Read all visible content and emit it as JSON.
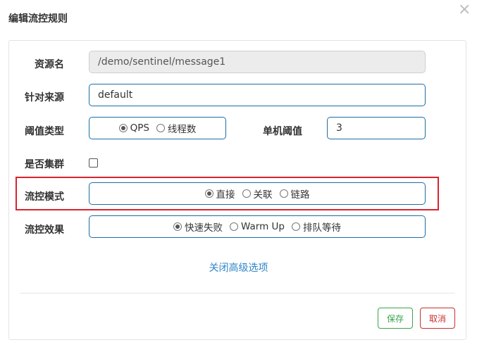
{
  "dialog": {
    "title": "编辑流控规则",
    "close_symbol": "×"
  },
  "form": {
    "resource": {
      "label": "资源名",
      "value": "/demo/sentinel/message1"
    },
    "limit_app": {
      "label": "针对来源",
      "value": "default"
    },
    "threshold_type": {
      "label": "阈值类型",
      "options": [
        "QPS",
        "线程数"
      ],
      "selected": "QPS"
    },
    "threshold": {
      "label": "单机阈值",
      "value": "3"
    },
    "cluster": {
      "label": "是否集群",
      "checked": false
    },
    "strategy": {
      "label": "流控模式",
      "options": [
        "直接",
        "关联",
        "链路"
      ],
      "selected": "直接"
    },
    "control_behavior": {
      "label": "流控效果",
      "options": [
        "快速失败",
        "Warm Up",
        "排队等待"
      ],
      "selected": "快速失败"
    }
  },
  "advanced_link": "关闭高级选项",
  "buttons": {
    "save": "保存",
    "cancel": "取消"
  },
  "colors": {
    "input_border": "#1b6ea6",
    "highlight_border": "#d9232e",
    "link": "#2f86c8",
    "save": "#3aa34a",
    "cancel": "#c9302c"
  }
}
